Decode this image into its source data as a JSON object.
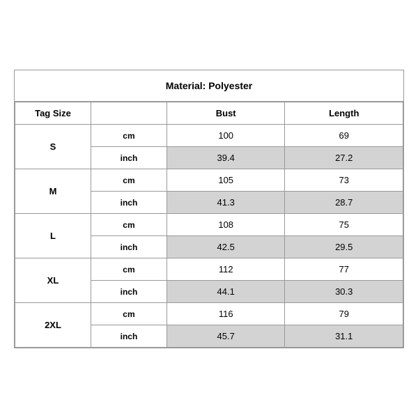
{
  "title": "Material: Polyester",
  "headers": {
    "tag_size": "Tag Size",
    "bust": "Bust",
    "length": "Length"
  },
  "sizes": [
    {
      "tag": "S",
      "cm": {
        "bust": "100",
        "length": "69"
      },
      "inch": {
        "bust": "39.4",
        "length": "27.2"
      }
    },
    {
      "tag": "M",
      "cm": {
        "bust": "105",
        "length": "73"
      },
      "inch": {
        "bust": "41.3",
        "length": "28.7"
      }
    },
    {
      "tag": "L",
      "cm": {
        "bust": "108",
        "length": "75"
      },
      "inch": {
        "bust": "42.5",
        "length": "29.5"
      }
    },
    {
      "tag": "XL",
      "cm": {
        "bust": "112",
        "length": "77"
      },
      "inch": {
        "bust": "44.1",
        "length": "30.3"
      }
    },
    {
      "tag": "2XL",
      "cm": {
        "bust": "116",
        "length": "79"
      },
      "inch": {
        "bust": "45.7",
        "length": "31.1"
      }
    }
  ],
  "units": {
    "cm": "cm",
    "inch": "inch"
  }
}
